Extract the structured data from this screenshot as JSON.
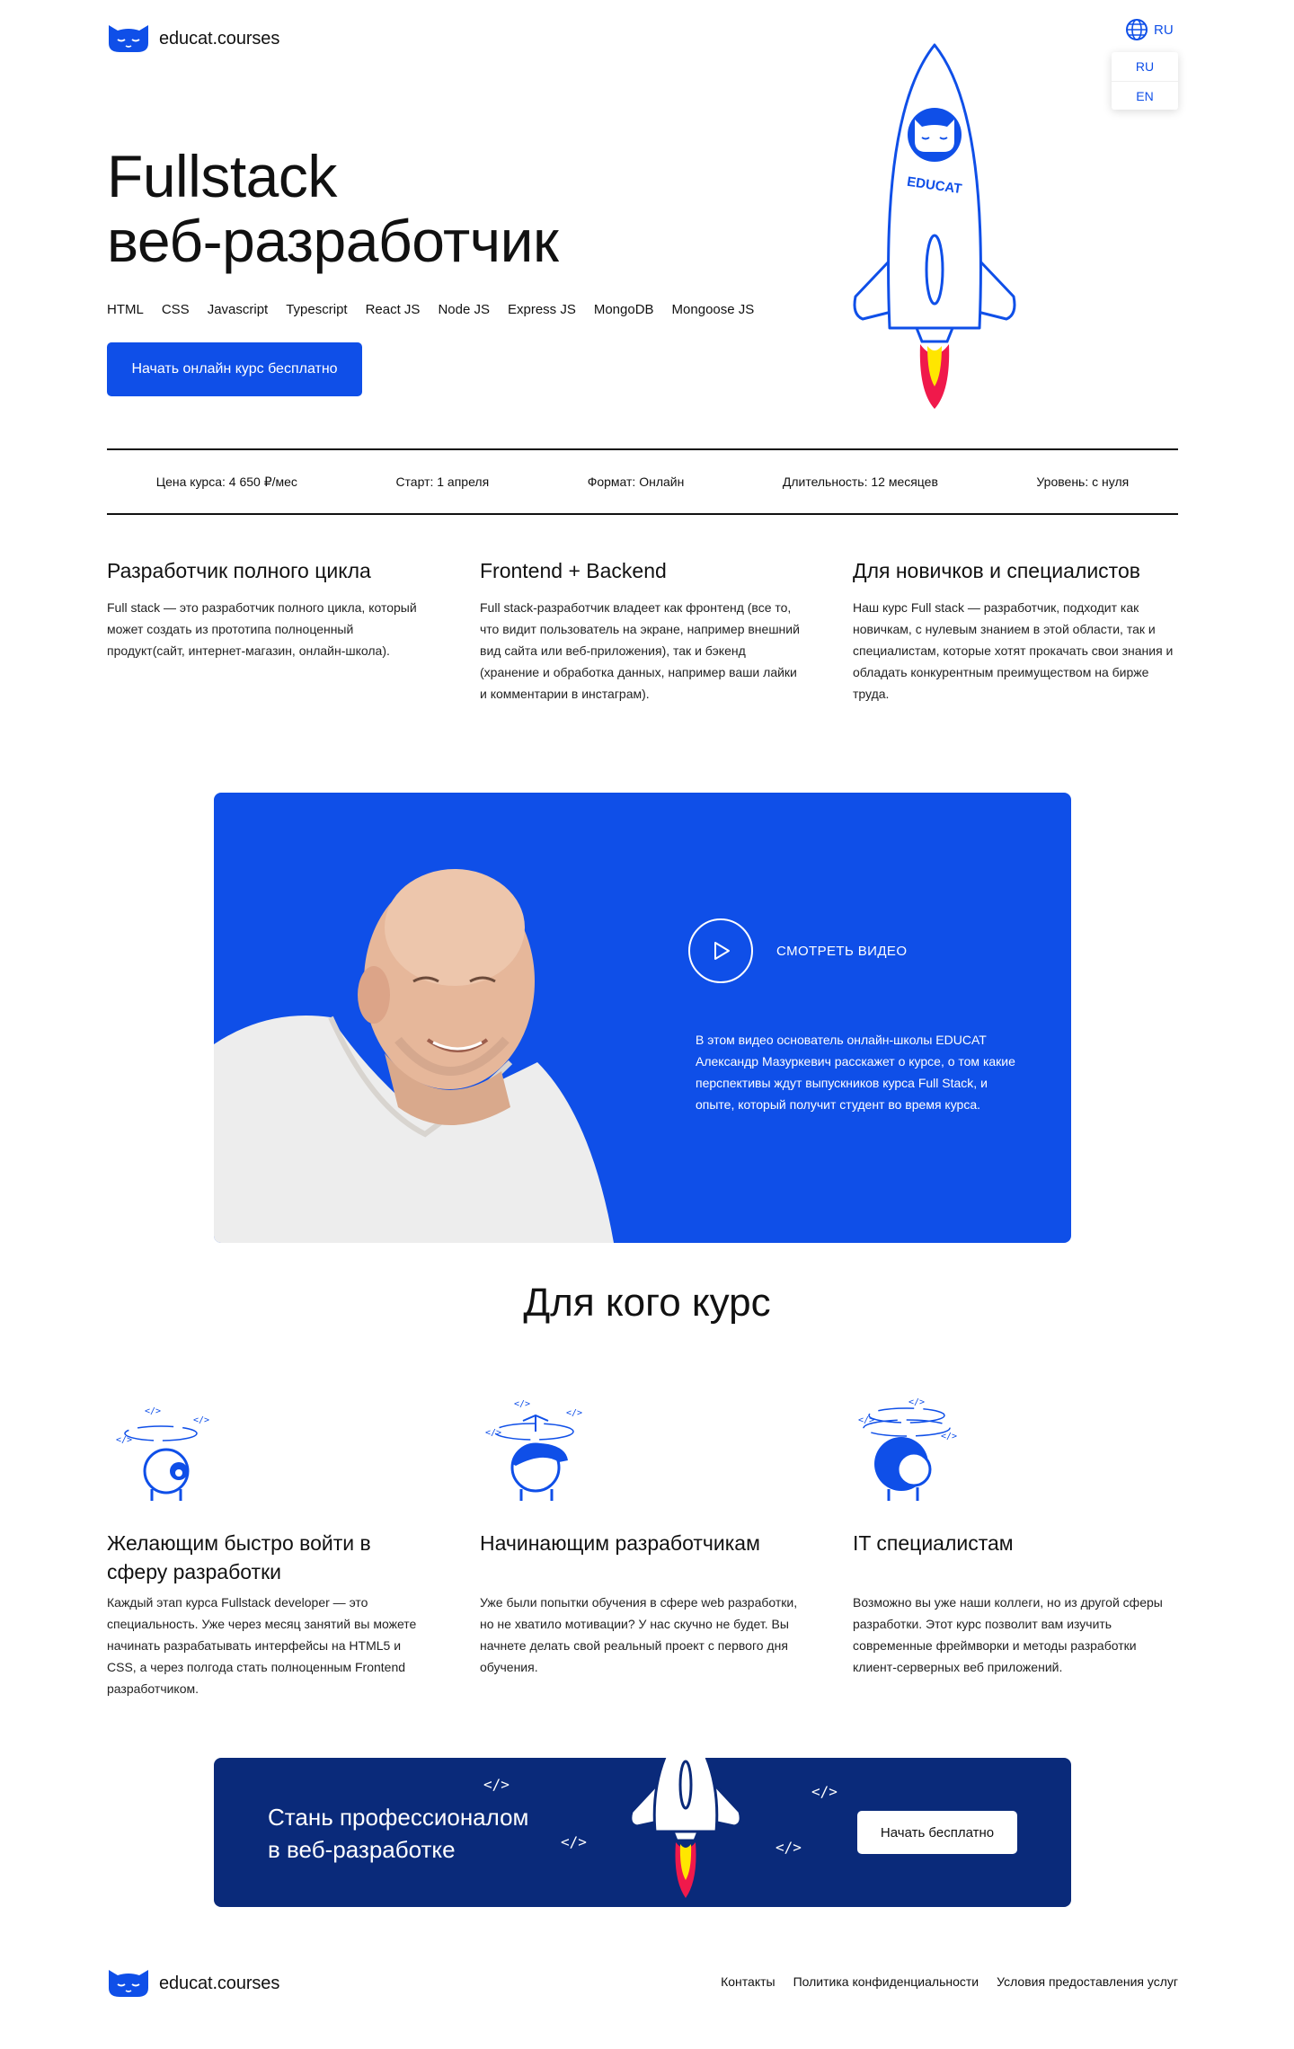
{
  "header": {
    "logo_text": "educat.courses",
    "lang_current": "RU",
    "lang_options": [
      "RU",
      "EN"
    ]
  },
  "hero": {
    "title_line1": "Fullstack",
    "title_line2": "веб-разработчик",
    "technologies": [
      "HTML",
      "CSS",
      "Javascript",
      "Typescript",
      "React JS",
      "Node JS",
      "Express JS",
      "MongoDB",
      "Mongoose JS"
    ],
    "cta_label": "Начать онлайн курс бесплатно",
    "rocket_label": "EDUCAT"
  },
  "stats": [
    "Цена курса: 4 650 ₽/мес",
    "Старт: 1 апреля",
    "Формат: Онлайн",
    "Длительность: 12 месяцев",
    "Уровень: с нуля"
  ],
  "features": [
    {
      "title": "Разработчик полного цикла",
      "text": "Full stack — это разработчик полного цикла, который может создать из прототипа полноценный продукт(сайт, интернет-магазин, онлайн-школа)."
    },
    {
      "title": "Frontend + Backend",
      "text": "Full stack-разработчик владеет как фронтенд (все то, что видит пользователь на экране, например внешний вид сайта или веб-приложения), так и бэкенд (хранение и обработка данных, например ваши лайки и комментарии в инстаграм)."
    },
    {
      "title": "Для новичков и специалистов",
      "text": "Наш курс Full stack — разработчик, подходит как новичкам, с нулевым знанием в этой области, так и специалистам, которые хотят прокачать свои знания и обладать конкурентным преимуществом на бирже труда."
    }
  ],
  "video": {
    "play_label": "СМОТРЕТЬ ВИДЕО",
    "description": "В этом видео основатель онлайн-школы EDUCAT Александр Мазуркевич расскажет о курсе, о том какие перспективы ждут выпускников курса Full Stack, и опыте, который получит студент во время курса."
  },
  "audience": {
    "title": "Для кого курс",
    "items": [
      {
        "title": "Желающим быстро войти в сферу разработки",
        "text": "Каждый этап курса Fullstack developer — это специальность. Уже через месяц занятий вы можете начинать разрабатывать интерфейсы на HTML5 и CSS, а через полгода стать полноценным Frontend разработчиком."
      },
      {
        "title": "Начинающим разработчикам",
        "text": "Уже были попытки обучения в сфере web разработки, но не хватило мотивации? У нас скучно не будет. Вы начнете делать свой реальный проект с первого дня обучения."
      },
      {
        "title": "IT специалистам",
        "text": "Возможно вы уже наши коллеги, но из другой сферы разработки. Этот курс позволит вам изучить современные фреймворки и методы разработки клиент-серверных веб приложений."
      }
    ]
  },
  "cta": {
    "title_line1": "Стань профессионалом",
    "title_line2": "в веб-разработке",
    "code_glyph": "</>",
    "button_label": "Начать бесплатно"
  },
  "footer": {
    "logo_text": "educat.courses",
    "links": [
      "Контакты",
      "Политика конфиденциальности",
      "Условия предоставления услуг"
    ]
  },
  "colors": {
    "brand_blue": "#0F4FE8",
    "cta_navy": "#0A2A7A",
    "flame_red": "#F0194B",
    "flame_yellow": "#FFE600"
  }
}
